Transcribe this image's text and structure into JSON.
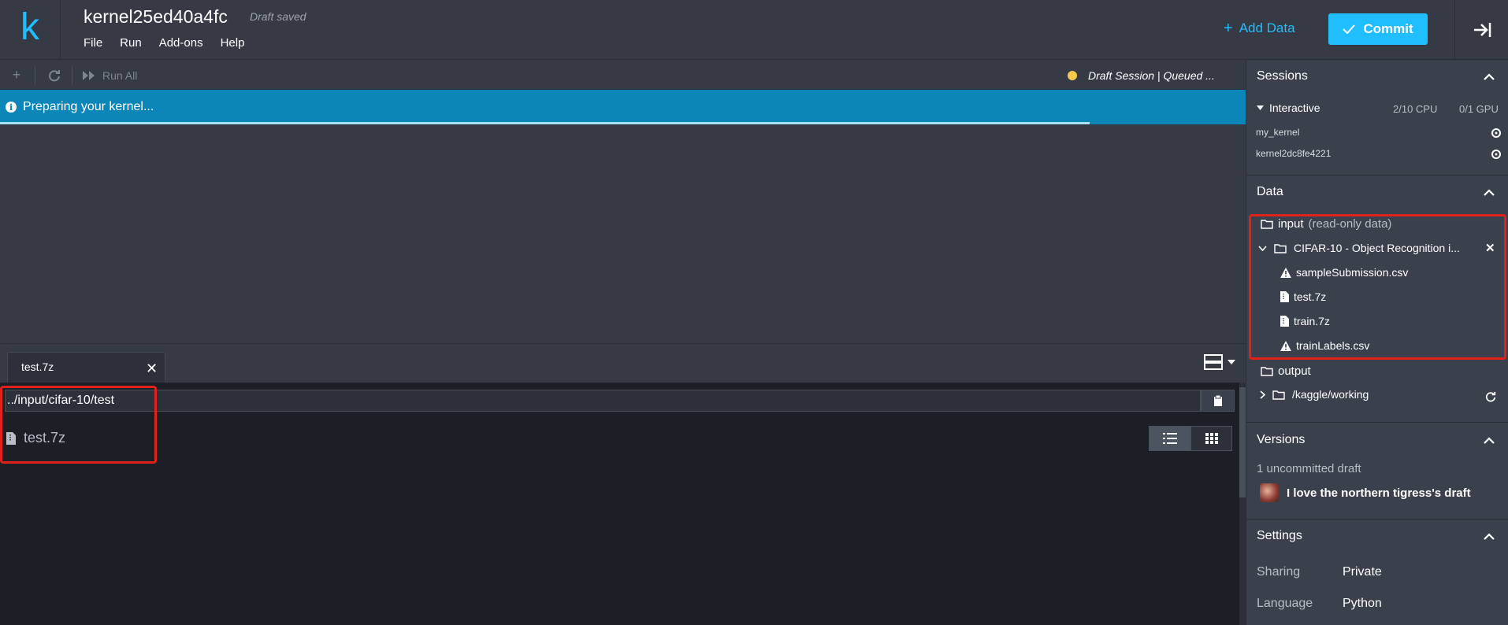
{
  "header": {
    "logo": "k",
    "title": "kernel25ed40a4fc",
    "save_status": "Draft saved",
    "menu": [
      "File",
      "Run",
      "Add-ons",
      "Help"
    ],
    "add_data_label": "Add Data",
    "commit_label": "Commit"
  },
  "toolbar": {
    "run_all_label": "Run All",
    "session_status": "Draft Session | Queued ...",
    "status_color": "#f5c94a"
  },
  "info_bar": {
    "message": "Preparing your kernel...",
    "progress": 0.875
  },
  "bottom_pane": {
    "tab_label": "test.7z",
    "path": "../input/cifar-10/test",
    "file_name": "test.7z"
  },
  "sessions": {
    "title": "Sessions",
    "group_label": "Interactive",
    "cpu": "2/10 CPU",
    "gpu": "0/1 GPU",
    "items": [
      "my_kernel",
      "kernel2dc8fe4221"
    ]
  },
  "data": {
    "title": "Data",
    "input_label": "input",
    "input_note": "(read-only data)",
    "dataset_label": "CIFAR-10 - Object Recognition i...",
    "files": [
      {
        "name": "sampleSubmission.csv",
        "icon": "warning-icon"
      },
      {
        "name": "test.7z",
        "icon": "file-icon"
      },
      {
        "name": "train.7z",
        "icon": "file-icon"
      },
      {
        "name": "trainLabels.csv",
        "icon": "warning-icon"
      }
    ],
    "output_label": "output",
    "working_dir": "/kaggle/working"
  },
  "versions": {
    "title": "Versions",
    "uncommitted": "1 uncommitted draft",
    "draft_title": "I love the northern tigress's draft"
  },
  "settings": {
    "title": "Settings",
    "sharing_label": "Sharing",
    "sharing_value": "Private",
    "language_label": "Language",
    "language_value": "Python"
  },
  "colors": {
    "accent": "#20beff",
    "info_bar": "#0c86b8",
    "highlight_box": "#e0221b"
  }
}
